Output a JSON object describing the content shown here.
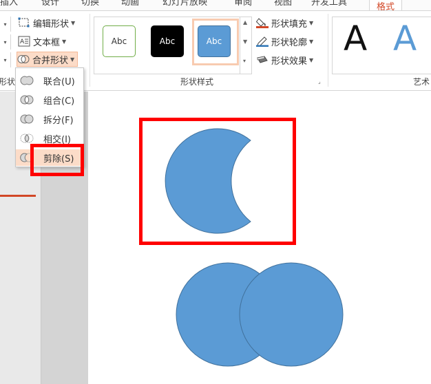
{
  "tabs": [
    {
      "label": "插入"
    },
    {
      "label": "设计"
    },
    {
      "label": "切换"
    },
    {
      "label": "动画"
    },
    {
      "label": "幻灯片放映"
    },
    {
      "label": "审阅"
    },
    {
      "label": "视图"
    },
    {
      "label": "开发工具"
    },
    {
      "label": "格式"
    }
  ],
  "ribbon": {
    "insert_shapes": {
      "edit_shape": "编辑形状",
      "text_box": "文本框",
      "merge_shapes": "合并形状",
      "group_label_partial": "形状"
    },
    "shape_styles": {
      "swatches": [
        "Abc",
        "Abc",
        "Abc"
      ],
      "group_label": "形状样式",
      "fill": "形状填充",
      "outline": "形状轮廓",
      "effects": "形状效果"
    },
    "wordart": {
      "letters": [
        "A",
        "A"
      ],
      "group_label_partial": "艺术"
    }
  },
  "merge_menu": {
    "items": [
      {
        "label": "联合(U)"
      },
      {
        "label": "组合(C)"
      },
      {
        "label": "拆分(F)"
      },
      {
        "label": "相交(I)"
      },
      {
        "label": "剪除(S)"
      }
    ]
  },
  "colors": {
    "accent": "#d24726",
    "shape_fill": "#5b9bd5",
    "shape_outline": "#41719c",
    "annotation_red": "#ff0000",
    "highlight": "#fcdcc8"
  }
}
